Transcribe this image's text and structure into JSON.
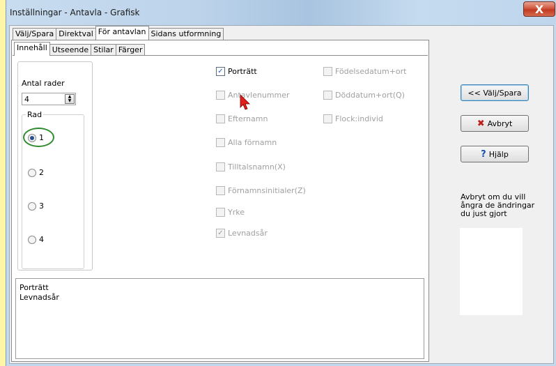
{
  "window": {
    "title": "Inställningar - Antavla - Grafisk",
    "close_label": "X"
  },
  "tabs_top": [
    {
      "label": "Välj/Spara",
      "active": false
    },
    {
      "label": "Direktval",
      "active": false
    },
    {
      "label": "För antavlan",
      "active": true
    },
    {
      "label": "Sidans utformning",
      "active": false
    }
  ],
  "tabs_inner": [
    {
      "label": "Innehåll",
      "active": true
    },
    {
      "label": "Utseende",
      "active": false
    },
    {
      "label": "Stilar",
      "active": false
    },
    {
      "label": "Färger",
      "active": false
    }
  ],
  "rows": {
    "label": "Antal rader",
    "value": "4",
    "group_label": "Rad",
    "options": [
      "1",
      "2",
      "3",
      "4"
    ],
    "selected": "1"
  },
  "checkboxes_col1": [
    {
      "label": "Porträtt",
      "checked": true,
      "enabled": true
    },
    {
      "label": "Antavlenummer",
      "checked": false,
      "enabled": false
    },
    {
      "label": "Efternamn",
      "checked": false,
      "enabled": false
    },
    {
      "label": "Alla förnamn",
      "checked": false,
      "enabled": false
    },
    {
      "label": "Tilltalsnamn(X)",
      "checked": false,
      "enabled": false
    },
    {
      "label": "Förnamnsinitialer(Z)",
      "checked": false,
      "enabled": false
    },
    {
      "label": "Yrke",
      "checked": false,
      "enabled": false
    },
    {
      "label": "Levnadsår",
      "checked": true,
      "enabled": false
    }
  ],
  "checkboxes_col2": [
    {
      "label": "Födelsedatum+ort",
      "checked": false,
      "enabled": false
    },
    {
      "label": "Döddatum+ort(Q)",
      "checked": false,
      "enabled": false
    },
    {
      "label": "Flock:individ",
      "checked": false,
      "enabled": false
    }
  ],
  "selected_list": [
    "Porträtt",
    "Levnadsår"
  ],
  "buttons": {
    "valj_spara": "<< Välj/Spara",
    "avbryt": "Avbryt",
    "hjalp": "Hjälp"
  },
  "help_text": "Avbryt om du vill ångra de ändringar du just gjort",
  "colors": {
    "background": "#fdf6a8",
    "avbryt_icon": "#c0201a",
    "hjalp_icon": "#1a4fb0",
    "highlight": "#2e8b2e",
    "cursor": "#e0201a"
  }
}
